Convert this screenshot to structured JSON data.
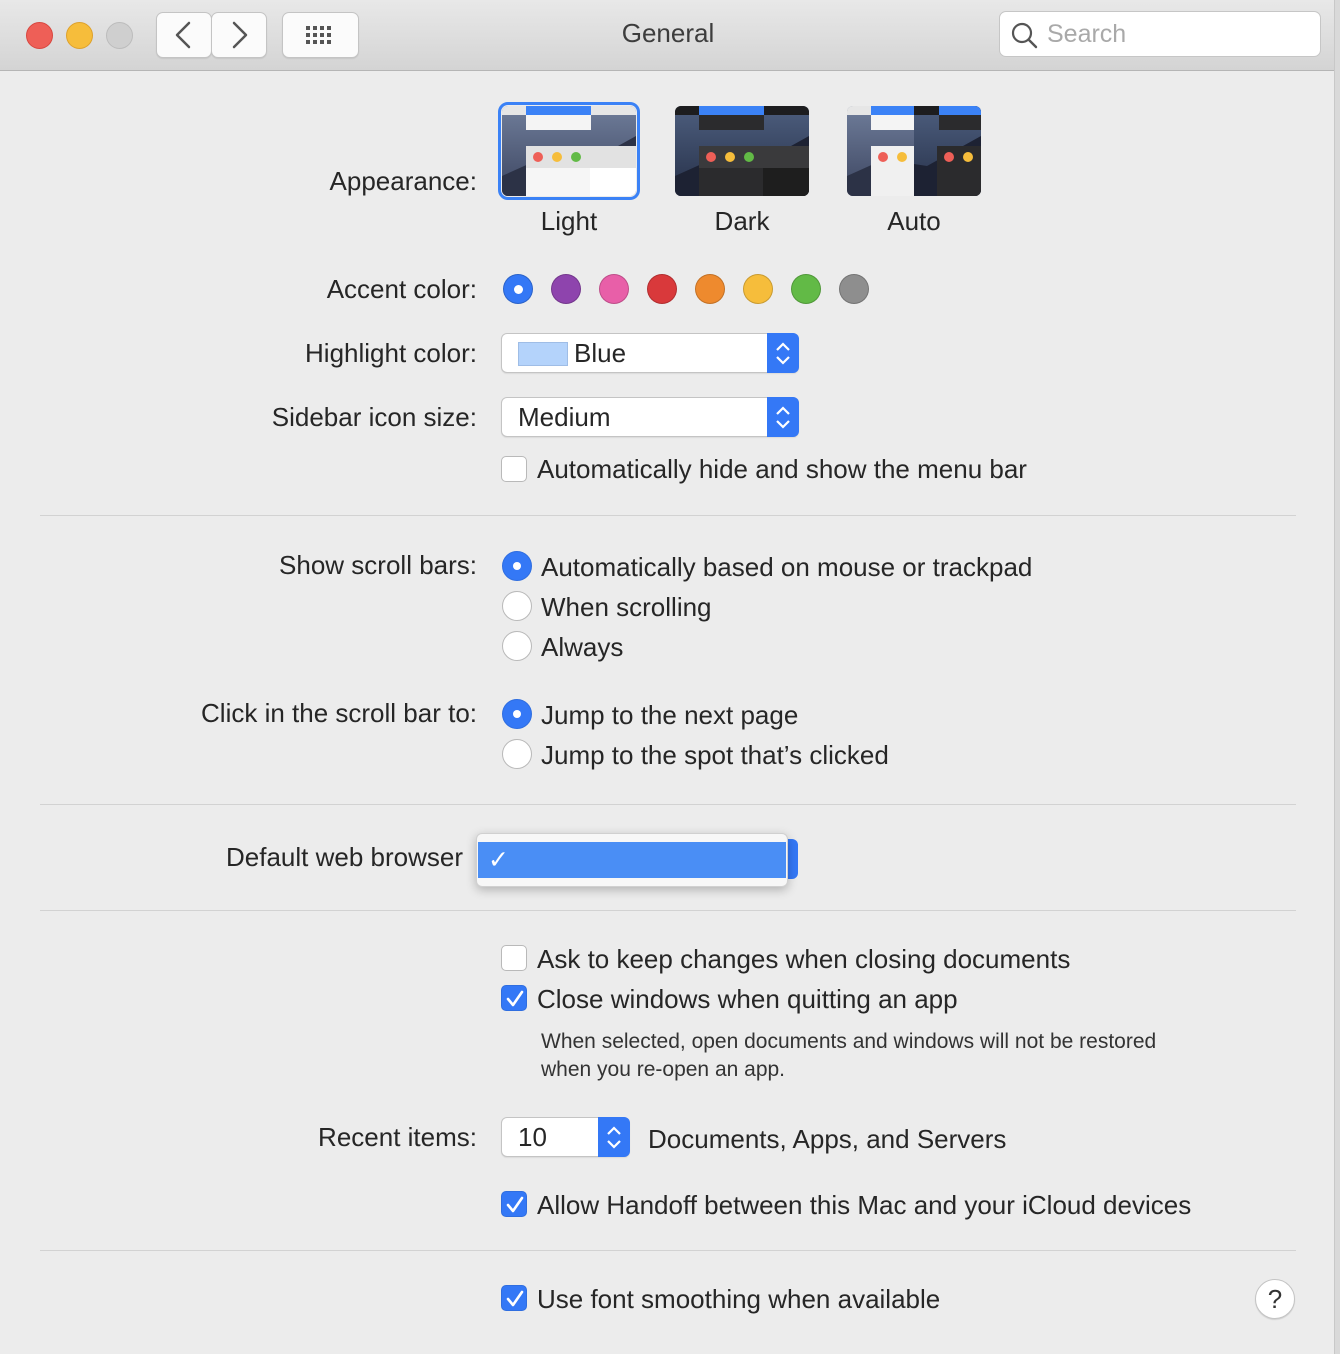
{
  "window": {
    "title": "General"
  },
  "toolbar": {
    "search_placeholder": "Search"
  },
  "appearance": {
    "label": "Appearance:",
    "options": [
      {
        "label": "Light",
        "selected": true
      },
      {
        "label": "Dark",
        "selected": false
      },
      {
        "label": "Auto",
        "selected": false
      }
    ]
  },
  "accent": {
    "label": "Accent color:",
    "colors": [
      "#3478f6",
      "#8e44ad",
      "#e85fa8",
      "#d9393b",
      "#ee8a2e",
      "#f6bd3b",
      "#62ba46",
      "#8e8e8e"
    ],
    "selected_index": 0
  },
  "highlight": {
    "label": "Highlight color:",
    "value": "Blue",
    "swatch": "#b4d3fb"
  },
  "sidebar_size": {
    "label": "Sidebar icon size:",
    "value": "Medium"
  },
  "menubar": {
    "label": "Automatically hide and show the menu bar",
    "checked": false
  },
  "scrollbars": {
    "label": "Show scroll bars:",
    "options": [
      "Automatically based on mouse or trackpad",
      "When scrolling",
      "Always"
    ],
    "selected_index": 0
  },
  "click_scroll": {
    "label": "Click in the scroll bar to:",
    "options": [
      "Jump to the next page",
      "Jump to the spot that’s clicked"
    ],
    "selected_index": 0
  },
  "browser": {
    "label": "Default web browser",
    "menu_check": "✓"
  },
  "documents": {
    "ask_keep": {
      "label": "Ask to keep changes when closing documents",
      "checked": false
    },
    "close_windows": {
      "label": "Close windows when quitting an app",
      "checked": true
    },
    "note_line1": "When selected, open documents and windows will not be restored",
    "note_line2": "when you re-open an app."
  },
  "recent": {
    "label": "Recent items:",
    "value": "10",
    "suffix": "Documents, Apps, and Servers"
  },
  "handoff": {
    "label": "Allow Handoff between this Mac and your iCloud devices",
    "checked": true
  },
  "smoothing": {
    "label": "Use font smoothing when available",
    "checked": true
  },
  "help": {
    "label": "?"
  }
}
